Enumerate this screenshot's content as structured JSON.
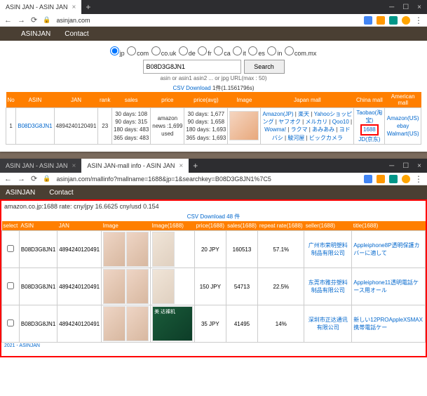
{
  "w1": {
    "tab": "ASIN JAN - ASIN JAN",
    "url": "asinjan.com",
    "brand": "ASINJAN",
    "contact": "Contact",
    "domains": [
      "jp",
      "com",
      "co.uk",
      "de",
      "fr",
      "ca",
      "it",
      "es",
      "in",
      "com.mx"
    ],
    "searchValue": "B08D3G8JN1",
    "searchBtn": "Search",
    "hint": "asin or asin1 asin2 ... or jpg URL(max : 50)",
    "csv": "CSV Download",
    "resultCount": "1件(1.1561796s)",
    "headers": [
      "No",
      "ASIN",
      "JAN",
      "rank",
      "sales",
      "price",
      "price(avg)",
      "Image",
      "Japan mall",
      "China mall",
      "American mall"
    ],
    "row": {
      "no": "1",
      "asin": "B08D3G8JN1",
      "jan": "4894240120491",
      "rank": "23",
      "priceLines": [
        "30 days: 108",
        "90 days: 315",
        "180 days: 483",
        "365 days: 483"
      ],
      "priceExtra": [
        "amazon",
        "news :1,699",
        "used"
      ],
      "avgLines": [
        "30 days: 1,677",
        "90 days: 1,658",
        "180 days: 1,693",
        "365 days: 1,693"
      ],
      "japan": [
        "Amazon(JP)",
        "楽天",
        "Yahooショッピング",
        "ヤフオク",
        "メルカリ",
        "Qoo10",
        "Wowma!",
        "ラクマ",
        "あみあみ",
        "ヨドバシ",
        "駿河屋",
        "ビックカメラ"
      ],
      "china": [
        "Taobao(淘宝)",
        "1688",
        "JD(京东)"
      ],
      "america": [
        "Amazon(US)",
        "ebay",
        "Walmart(US)"
      ]
    }
  },
  "w2": {
    "tab1": "ASIN JAN - ASIN JAN",
    "tab2": "ASIN JAN-mall info - ASIN JAN",
    "url": "asinjan.com/mallinfo?mallname=1688&jp=1&searchkey=B08D3G8JN1%7C5",
    "brand": "ASINJAN",
    "contact": "Contact",
    "rate": "amazon.co.jp:1688 rate: cny/jpy 16.6625 cny/usd 0.154",
    "csv": "CSV Download",
    "csvCount": "48 件",
    "headers": [
      "select",
      "ASIN",
      "JAN",
      "Image",
      "Image(1688)",
      "price(1688)",
      "sales(1688)",
      "repeat rate(1688)",
      "seller(1688)",
      "title(1688)"
    ],
    "rows": [
      {
        "asin": "B08D3G8JN1",
        "jan": "4894240120491",
        "price": "20 JPY",
        "sales": "160513",
        "rate": "57.1%",
        "seller": "广州市荣明塑料制品有限公司",
        "title": "Appleiphone8P透明保護カバーに適して"
      },
      {
        "asin": "B08D3G8JN1",
        "jan": "4894240120491",
        "price": "150 JPY",
        "sales": "54713",
        "rate": "22.5%",
        "seller": "东莞市雅芬塑料制品有限公司",
        "title": "Appleiphone11透明電話ケース用オール"
      },
      {
        "asin": "B08D3G8JN1",
        "jan": "4894240120491",
        "price": "35 JPY",
        "sales": "41495",
        "rate": "14%",
        "seller": "深圳市正达通讯有限公司",
        "title": "新しい12PROAppleXSMAX携帯電話ケー"
      }
    ],
    "footer": "2021 - ASINJAN"
  }
}
